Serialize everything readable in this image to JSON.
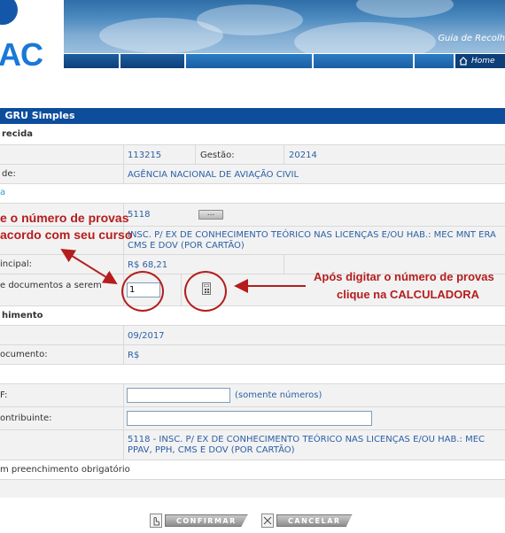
{
  "header": {
    "logo_text": "AC",
    "banner_title": "Guia de Recolh",
    "home_label": "Home"
  },
  "form": {
    "title": "GRU Simples",
    "section_recolhimento_ug": "recida",
    "ug_code": "113215",
    "gestao_label": "Gestão:",
    "gestao_value": "20214",
    "unidade_label": "de:",
    "unidade_value": "AGÊNCIA NACIONAL DE AVIAÇÃO CIVIL",
    "blue_marker": "a",
    "codigo_value": "5118",
    "lookup_button": "...",
    "descricao_line1": "INSC. P/ EX DE CONHECIMENTO TEÓRICO NAS LICENÇAS E/OU HAB.: MEC MNT ERA",
    "descricao_line2": "CMS E DOV (POR CARTÃO)",
    "principal_label": "incipal:",
    "principal_value": "R$ 68,21",
    "qtd_label": "e documentos a serem",
    "qtd_value": "1",
    "section_preenchimento": "himento",
    "competencia_value": "09/2017",
    "valor_doc_label": "ocumento:",
    "valor_doc_value": "R$",
    "cpf_label": "F:",
    "cpf_value": "",
    "cpf_hint": "(somente números)",
    "contribuinte_label": "ontribuinte:",
    "contribuinte_value": "",
    "resumo_line1": "5118  -  INSC. P/ EX DE CONHECIMENTO TEÓRICO NAS LICENÇAS E/OU HAB.: MEC",
    "resumo_line2": "PPAV, PPH, CMS E DOV (POR CARTÃO)",
    "obrigatorio_note": "m preenchimento obrigatório"
  },
  "annotations": {
    "left_line1": "e o número de provas",
    "left_line2": "acordo com seu curso",
    "right_line1": "Após digitar o número de provas",
    "right_line2": "clique na CALCULADORA"
  },
  "actions": {
    "confirm_label": "CONFIRMAR",
    "cancel_label": "CANCELAR"
  },
  "colors": {
    "title_bar": "#0c4d9c",
    "link_blue": "#2b5fa5",
    "annotation_red": "#b51d1d"
  }
}
